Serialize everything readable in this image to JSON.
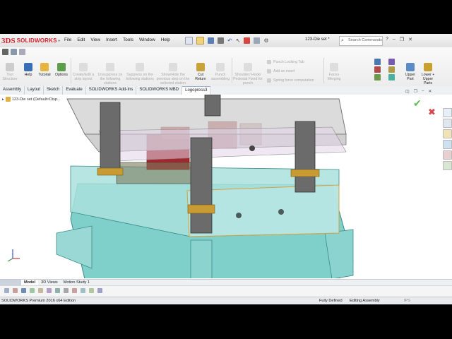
{
  "app": {
    "brand_prefix": "3DS",
    "brand": "SOLIDWORKS",
    "document": "123-Die set *",
    "search_placeholder": "Search Commands"
  },
  "menu": [
    "File",
    "Edit",
    "View",
    "Insert",
    "Tools",
    "Window",
    "Help"
  ],
  "ribbon": {
    "buttons": [
      {
        "label": "Tool Structure",
        "enabled": false
      },
      {
        "label": "Help",
        "enabled": true
      },
      {
        "label": "Tutorial",
        "enabled": true
      },
      {
        "label": "Options",
        "enabled": true
      },
      {
        "label": "Create/Edit a strip layout",
        "enabled": false
      },
      {
        "label": "Unsuppress on the following stations",
        "enabled": false
      },
      {
        "label": "Suppress on the following stations",
        "enabled": false
      },
      {
        "label": "Show/Hide the previous step on the selected station",
        "enabled": false
      },
      {
        "label": "Cut Return",
        "enabled": true
      },
      {
        "label": "Punch assembling",
        "enabled": false
      },
      {
        "label": "Shoulder/ Hook/ Pedestal Fixed for punch",
        "enabled": false
      },
      {
        "label": "Faces Merging",
        "enabled": false
      },
      {
        "label": "Upper Part",
        "enabled": true
      },
      {
        "label": "Lower + Upper Parts",
        "enabled": true
      }
    ],
    "small": [
      "Punch Locking Tab",
      "Add an insert",
      "Spring force computation"
    ]
  },
  "tabs": [
    {
      "label": "Assembly",
      "active": false
    },
    {
      "label": "Layout",
      "active": false
    },
    {
      "label": "Sketch",
      "active": false
    },
    {
      "label": "Evaluate",
      "active": false
    },
    {
      "label": "SOLIDWORKS Add-Ins",
      "active": false
    },
    {
      "label": "SOLIDWORKS MBD",
      "active": false
    },
    {
      "label": "Logopress3",
      "active": true
    }
  ],
  "tree": {
    "item": "123-Die set  (Default<Disp..."
  },
  "bottom_tabs": [
    {
      "label": "Model",
      "active": true
    },
    {
      "label": "3D Views",
      "active": false
    },
    {
      "label": "Motion Study 1",
      "active": false
    }
  ],
  "status": {
    "product": "SOLIDWORKS Premium 2016 x64 Edition",
    "defined": "Fully Defined",
    "mode": "Editing Assembly",
    "units": "IPS"
  },
  "colors": {
    "accent": "#d8202b",
    "die_shoe": "#6fc7c4",
    "plate_glass": "#c9c9c9",
    "punch_red": "#a3262d",
    "post": "#6b6b6b",
    "bushing": "#c89b34"
  }
}
